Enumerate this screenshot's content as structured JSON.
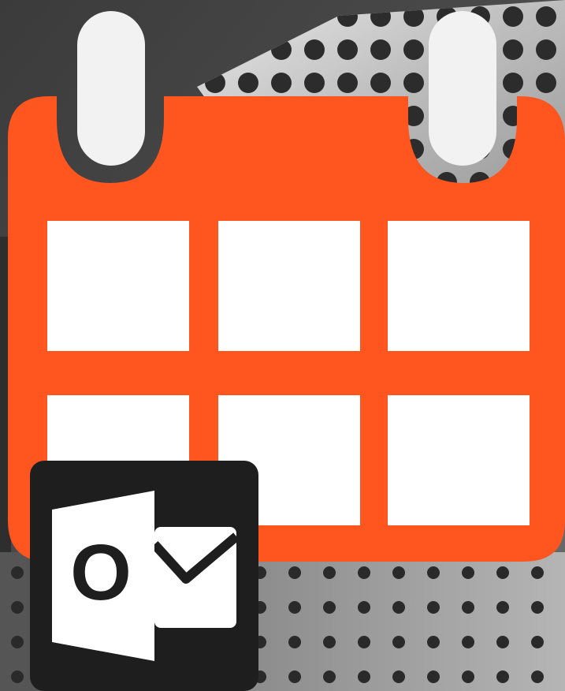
{
  "image": {
    "description_free": true,
    "icons": [
      "calendar-icon",
      "outlook-icon"
    ]
  },
  "colors": {
    "background_dark": "#3a3a3a",
    "background_mid": "#6a6a6a",
    "background_light": "#cfcfcf",
    "calendar_orange": "#ff5620",
    "calendar_cells": "#ffffff",
    "ring_fill": "#f2f2f2",
    "outlook_tile": "#1e1e1e",
    "outlook_glyph": "#ffffff"
  },
  "outlook": {
    "letter": "O"
  }
}
